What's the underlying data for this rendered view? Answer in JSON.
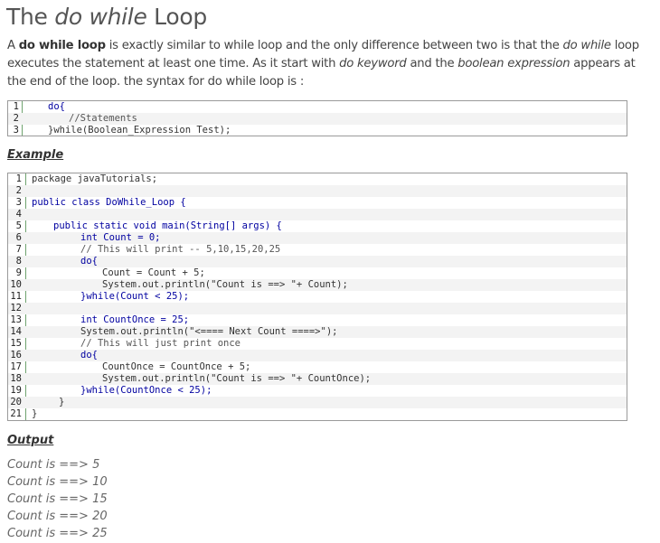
{
  "title": {
    "prefix": "The ",
    "italic": "do while",
    "suffix": " Loop"
  },
  "intro": {
    "p1": "A ",
    "b1": "do while loop",
    "p2": " is exactly similar to while loop and the only difference between two is that the ",
    "i1": "do while",
    "p3": " loop executes the statement at least one time. As it start with ",
    "i2": "do keyword",
    "p4": " and the ",
    "i3": "boolean expression",
    "p5": " appears at the end of the loop. the syntax for do while loop is :"
  },
  "syntax_block": {
    "lines": [
      {
        "n": "1",
        "text": "do{"
      },
      {
        "n": "2",
        "text": "//Statements"
      },
      {
        "n": "3",
        "text": "}while(Boolean_Expression Test);"
      }
    ]
  },
  "example_heading": "Example",
  "example_block": {
    "lines": [
      {
        "n": "1",
        "text": "package javaTutorials;"
      },
      {
        "n": "2",
        "text": ""
      },
      {
        "n": "3",
        "text": "public class DoWhile_Loop {"
      },
      {
        "n": "4",
        "text": ""
      },
      {
        "n": "5",
        "text": "public static void main(String[] args) {"
      },
      {
        "n": "6",
        "text": "int Count = 0;"
      },
      {
        "n": "7",
        "text": "// This will print -- 5,10,15,20,25"
      },
      {
        "n": "8",
        "text": "do{"
      },
      {
        "n": "9",
        "text": "Count = Count + 5;"
      },
      {
        "n": "10",
        "text": "System.out.println(\"Count is ==> \"+ Count);"
      },
      {
        "n": "11",
        "text": "}while(Count < 25);"
      },
      {
        "n": "12",
        "text": ""
      },
      {
        "n": "13",
        "text": "int CountOnce = 25;"
      },
      {
        "n": "14",
        "text": "System.out.println(\"<==== Next Count ====>\");"
      },
      {
        "n": "15",
        "text": "// This will just print once"
      },
      {
        "n": "16",
        "text": "do{"
      },
      {
        "n": "17",
        "text": "CountOnce = CountOnce + 5;"
      },
      {
        "n": "18",
        "text": "System.out.println(\"Count is ==> \"+ CountOnce);"
      },
      {
        "n": "19",
        "text": "}while(CountOnce < 25);"
      },
      {
        "n": "20",
        "text": "}"
      },
      {
        "n": "21",
        "text": "}"
      }
    ]
  },
  "output_heading": "Output",
  "output_lines": [
    "Count is ==> 5",
    "Count is ==> 10",
    "Count is ==> 15",
    "Count is ==> 20",
    "Count is ==> 25"
  ]
}
